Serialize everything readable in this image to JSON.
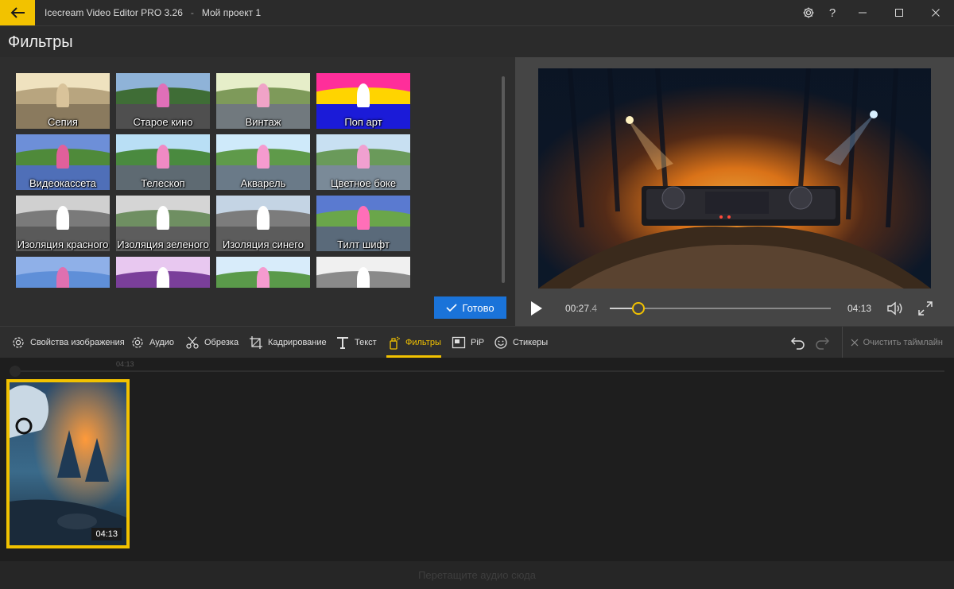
{
  "titlebar": {
    "app_name": "Icecream Video Editor PRO 3.26",
    "separator": "-",
    "project_name": "Мой проект 1",
    "settings_icon": "gear-icon",
    "help_label": "?",
    "minimize_icon": "minimize-icon",
    "maximize_icon": "maximize-icon",
    "close_icon": "close-icon"
  },
  "header": {
    "title": "Фильтры"
  },
  "filters": {
    "items": [
      {
        "label": "Сепия",
        "sky": "#efe2bf",
        "hill": "#b8a57f",
        "road": "#8a7a5e",
        "cone": "#d9c39a"
      },
      {
        "label": "Старое кино",
        "sky": "#8fb3d8",
        "hill": "#3f6d36",
        "road": "#4f4f4f",
        "cone": "#e06fb8"
      },
      {
        "label": "Винтаж",
        "sky": "#e6eec9",
        "hill": "#7e9a5a",
        "road": "#71797e",
        "cone": "#f0a3c7"
      },
      {
        "label": "Поп арт",
        "sky": "#ff2e9a",
        "hill": "#ffd400",
        "road": "#1b1bd8",
        "cone": "#ffffff"
      },
      {
        "label": "Видеокассета",
        "sky": "#6d8fd8",
        "hill": "#4f8a3a",
        "road": "#4f6fb8",
        "cone": "#e0609b"
      },
      {
        "label": "Телескоп",
        "sky": "#b9dff5",
        "hill": "#4a8a3f",
        "road": "#5e6a72",
        "cone": "#f08ac4"
      },
      {
        "label": "Акварель",
        "sky": "#cfeafa",
        "hill": "#5f9a4a",
        "road": "#6a7a88",
        "cone": "#f59bcf"
      },
      {
        "label": "Цветное боке",
        "sky": "#c8e0f2",
        "hill": "#6a9a5a",
        "road": "#7a8a98",
        "cone": "#f0a0d0"
      },
      {
        "label": "Изоляция красного",
        "sky": "#d0d0d0",
        "hill": "#7a7a7a",
        "road": "#5a5a5a",
        "cone": "#ffffff"
      },
      {
        "label": "Изоляция зеленого",
        "sky": "#d5d5d5",
        "hill": "#6f8f62",
        "road": "#5d5d5d",
        "cone": "#ffffff"
      },
      {
        "label": "Изоляция синего",
        "sky": "#c4d4e4",
        "hill": "#7c7c7c",
        "road": "#5c5c5c",
        "cone": "#ffffff"
      },
      {
        "label": "Тилт шифт",
        "sky": "#5a7ad0",
        "hill": "#6aa64a",
        "road": "#5a6a7a",
        "cone": "#ff6fb8"
      },
      {
        "label": "",
        "sky": "#8fb0e8",
        "hill": "#5f8fd8",
        "road": "#7a9ad8",
        "cone": "#e070b0"
      },
      {
        "label": "",
        "sky": "#e8c8f0",
        "hill": "#7a3f9a",
        "road": "#4a2f6a",
        "cone": "#ffffff"
      },
      {
        "label": "",
        "sky": "#d8ecfa",
        "hill": "#5a9a4a",
        "road": "#6a7a88",
        "cone": "#f59bcf"
      },
      {
        "label": "",
        "sky": "#f0f0f0",
        "hill": "#8a8a8a",
        "road": "#6a6a6a",
        "cone": "#ffffff"
      }
    ],
    "done_label": "Готово"
  },
  "player": {
    "time_current": "00:27",
    "time_fraction": ".4",
    "time_total": "04:13",
    "progress": 0.13
  },
  "toolbar": {
    "tools": [
      {
        "label": "Свойства изображения",
        "icon": "image-settings-icon"
      },
      {
        "label": "Аудио",
        "icon": "audio-settings-icon"
      },
      {
        "label": "Обрезка",
        "icon": "scissors-icon"
      },
      {
        "label": "Кадрирование",
        "icon": "crop-icon"
      },
      {
        "label": "Текст",
        "icon": "text-icon"
      },
      {
        "label": "Фильтры",
        "icon": "filter-spray-icon"
      },
      {
        "label": "PiP",
        "icon": "pip-icon"
      },
      {
        "label": "Стикеры",
        "icon": "sticker-icon"
      }
    ],
    "active_tool": "Фильтры",
    "clear_label": "Очистить таймлайн"
  },
  "timeline": {
    "ruler_label": "04:13",
    "clip_duration": "04:13",
    "audio_drop_label": "Перетащите аудио сюда"
  },
  "colors": {
    "accent": "#f2c200",
    "primary_button": "#1a73d9"
  }
}
